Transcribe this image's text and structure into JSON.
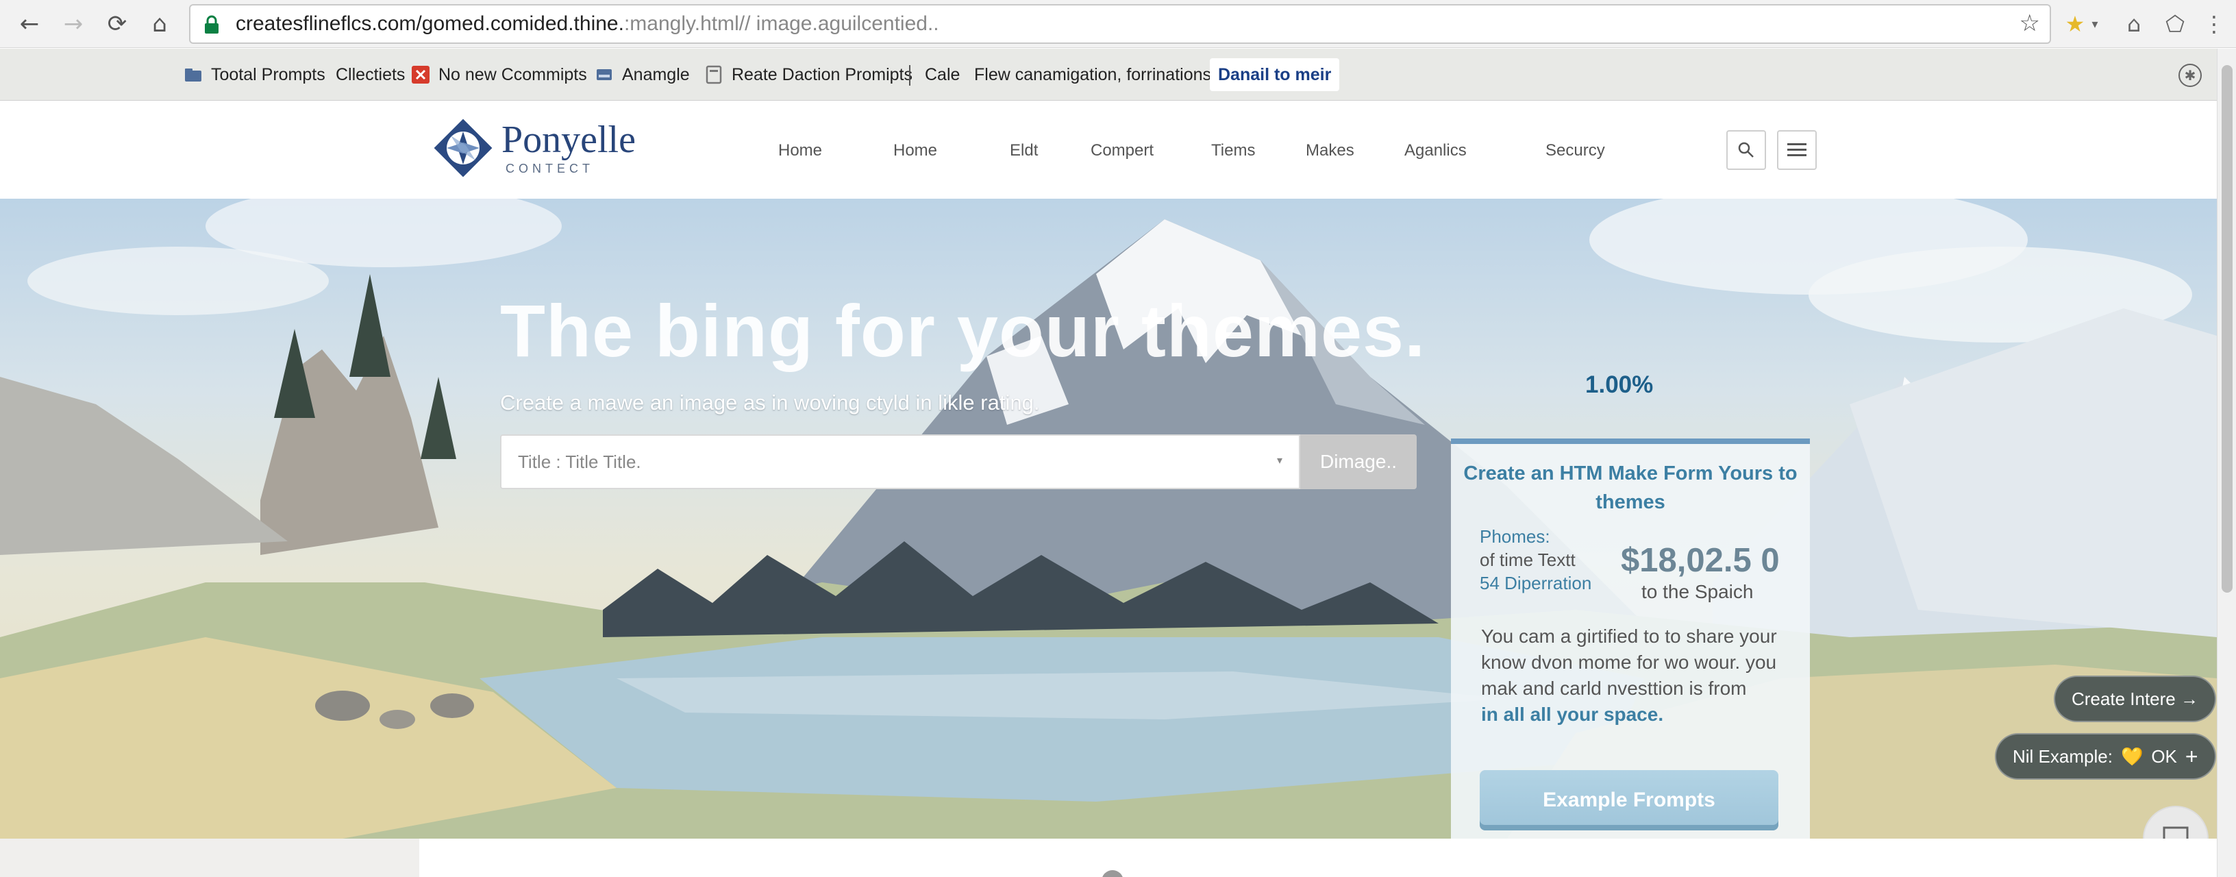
{
  "browser": {
    "url_host": "createsflineflcs.com/gomed.comided.thine.",
    "url_path": ":mangly.html// image.aguilcentied..",
    "nav": {
      "back": "←",
      "forward": "→",
      "reload": "⟳",
      "home": "⌂"
    },
    "bookmarks": [
      {
        "label": "Tootal Prompts",
        "icon": "folder-icon",
        "color": "#4f6e9b"
      },
      {
        "label": "Cllectiets",
        "icon": "",
        "color": ""
      },
      {
        "label": "No new Ccommipts",
        "icon": "close-box-icon",
        "color": "#d63b2b"
      },
      {
        "label": "Anamgle",
        "icon": "drive-icon",
        "color": "#4f6e9b"
      },
      {
        "label": "Reate Daction Promipts",
        "icon": "page-icon",
        "color": "#777777"
      },
      {
        "label": "Cale",
        "icon": "",
        "color": ""
      },
      {
        "label": "Flew canamigation, forrinations",
        "icon": "",
        "color": ""
      },
      {
        "label": "Danail to meir",
        "icon": "",
        "color": ""
      }
    ]
  },
  "header": {
    "logo_name": "Ponyelle",
    "logo_sub": "CONTECT",
    "nav": [
      "Home",
      "Home",
      "Eldt",
      "Compert",
      "Tiems",
      "Makes",
      "Aganlics",
      "Securcy"
    ],
    "search_icon": "search-icon",
    "menu_icon": "hamburger-icon"
  },
  "hero": {
    "title": "The bing for your themes.",
    "subtitle": "Create a mawe an image as in woving ctyld in likle rating.",
    "input_placeholder": "Title : Title Title.",
    "button_label": "Dimage..",
    "percent": "1.00%"
  },
  "card": {
    "title": "Create an HTM Make Form Yours to themes",
    "label_phones": "Phomes:",
    "label_text": "of time Textt",
    "label_depreciation": "54 Diperration",
    "price": "$18,02.5 0",
    "price_sub": "to the Spaich",
    "body": "You cam a girtified to to share your know dvon mome for wo wour. you mak and carld nvesttion is from",
    "body_strong": "in all all your space.",
    "cta": "Example Frompts"
  },
  "floating": {
    "create": "Create Intere →",
    "example": "Nil Example:",
    "ok": "OK",
    "plus": "+",
    "heart": "💛"
  },
  "colors": {
    "brand": "#28457a",
    "accent": "#3c7fa3",
    "card_top": "#6c9ac0"
  }
}
